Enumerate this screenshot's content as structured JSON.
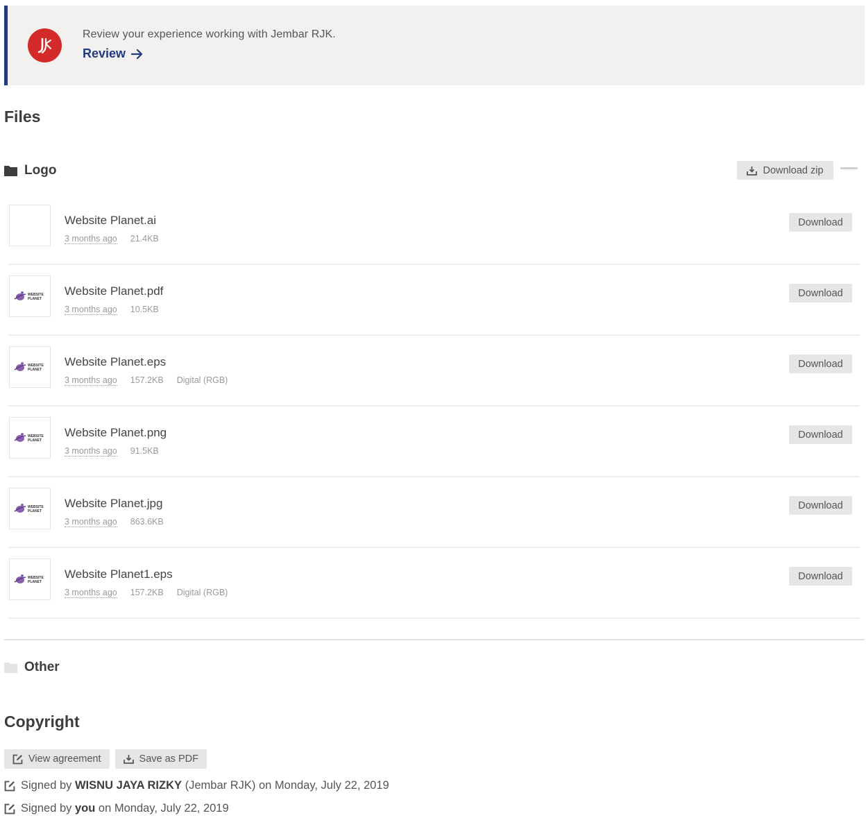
{
  "banner": {
    "message": "Review your experience working with Jembar RJK.",
    "link_label": "Review",
    "avatar_initials": "JR",
    "accent_color": "#233a7f",
    "avatar_color": "#d52a2a"
  },
  "files": {
    "heading": "Files",
    "folders": [
      {
        "name": "Logo",
        "download_zip_label": "Download zip",
        "items": [
          {
            "name": "Website Planet.ai",
            "age": "3 months ago",
            "size": "21.4KB",
            "color_mode": "",
            "has_preview": false,
            "download_label": "Download"
          },
          {
            "name": "Website Planet.pdf",
            "age": "3 months ago",
            "size": "10.5KB",
            "color_mode": "",
            "has_preview": true,
            "download_label": "Download"
          },
          {
            "name": "Website Planet.eps",
            "age": "3 months ago",
            "size": "157.2KB",
            "color_mode": "Digital (RGB)",
            "has_preview": true,
            "download_label": "Download"
          },
          {
            "name": "Website Planet.png",
            "age": "3 months ago",
            "size": "91.5KB",
            "color_mode": "",
            "has_preview": true,
            "download_label": "Download"
          },
          {
            "name": "Website Planet.jpg",
            "age": "3 months ago",
            "size": "863.6KB",
            "color_mode": "",
            "has_preview": true,
            "download_label": "Download"
          },
          {
            "name": "Website Planet1.eps",
            "age": "3 months ago",
            "size": "157.2KB",
            "color_mode": "Digital (RGB)",
            "has_preview": true,
            "download_label": "Download"
          }
        ]
      },
      {
        "name": "Other"
      }
    ],
    "thumb_text": [
      "WEBSITE",
      "PLANET"
    ]
  },
  "copyright": {
    "heading": "Copyright",
    "view_agreement_label": "View agreement",
    "save_pdf_label": "Save as PDF",
    "signatures": [
      {
        "prefix": "Signed by ",
        "who": "WISNU JAYA RIZKY",
        "suffix": " (Jembar RJK) on Monday, July 22, 2019"
      },
      {
        "prefix": "Signed by ",
        "who": "you",
        "suffix": " on Monday, July 22, 2019"
      }
    ]
  }
}
